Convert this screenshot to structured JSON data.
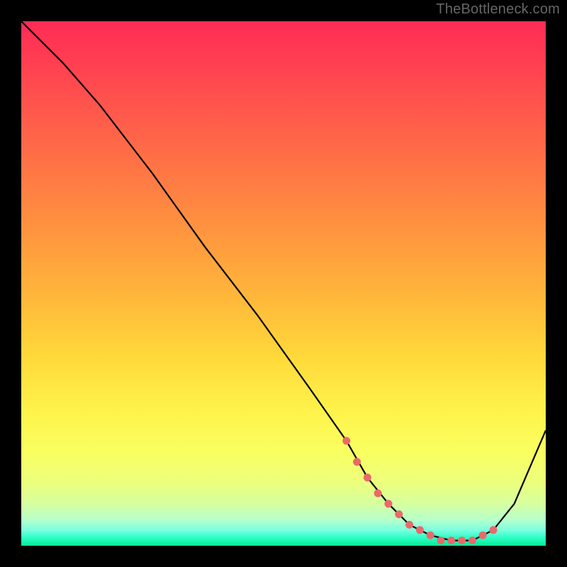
{
  "attribution": "TheBottleneck.com",
  "chart_data": {
    "type": "line",
    "title": "",
    "xlabel": "",
    "ylabel": "",
    "xlim": [
      0,
      100
    ],
    "ylim": [
      0,
      100
    ],
    "series": [
      {
        "name": "curve",
        "x": [
          0,
          4,
          8,
          15,
          25,
          35,
          45,
          55,
          62,
          66,
          70,
          74,
          78,
          82,
          86,
          90,
          94,
          100
        ],
        "y": [
          100,
          96,
          92,
          84,
          71,
          57,
          44,
          30,
          20,
          13,
          8,
          4,
          2,
          1,
          1,
          3,
          8,
          22
        ]
      }
    ],
    "markers": {
      "comment": "salmon dotted segments near the valley",
      "x": [
        62,
        64,
        66,
        68,
        70,
        72,
        74,
        76,
        78,
        80,
        82,
        84,
        86,
        88,
        90
      ],
      "y": [
        20,
        16,
        13,
        10,
        8,
        6,
        4,
        3,
        2,
        1,
        1,
        1,
        1,
        2,
        3
      ]
    },
    "colors": {
      "curve": "#000000",
      "marker": "#e86a6a"
    }
  }
}
